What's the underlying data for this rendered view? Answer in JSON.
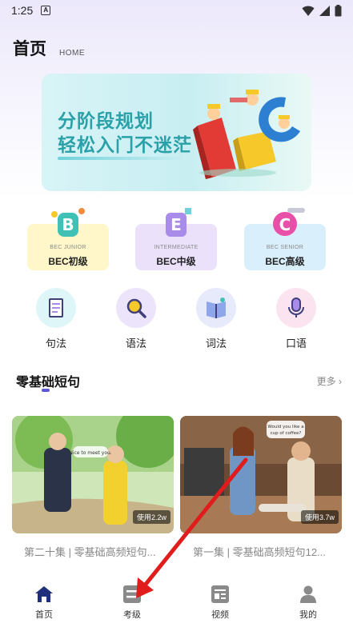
{
  "status_bar": {
    "time": "1:25",
    "a_badge": "A"
  },
  "header": {
    "title": "首页",
    "subtitle": "HOME"
  },
  "banner": {
    "line1": "分阶段规划",
    "line2": "轻松入门不迷茫"
  },
  "levels": [
    {
      "name": "BEC初级",
      "tag": "BEC JUNIOR",
      "color": "#fff6c9",
      "letter": "B"
    },
    {
      "name": "BEC中级",
      "tag": "INTERMEDIATE",
      "color": "#ebe1fb",
      "letter": "E"
    },
    {
      "name": "BEC高级",
      "tag": "BEC SENIOR",
      "color": "#d9effc",
      "letter": "C"
    }
  ],
  "skills": [
    {
      "label": "句法",
      "icon": "notebook-icon"
    },
    {
      "label": "语法",
      "icon": "magnifier-icon"
    },
    {
      "label": "词法",
      "icon": "book-icon"
    },
    {
      "label": "口语",
      "icon": "microphone-icon"
    }
  ],
  "section": {
    "title": "零基础短句",
    "more": "更多"
  },
  "videos": [
    {
      "caption": "第二十集 | 零基础高频短句...",
      "usage": "使用2.2w",
      "bubble": "Nice to meet you."
    },
    {
      "caption": "第一集 | 零基础高频短句12...",
      "usage": "使用3.7w",
      "bubble": "Would you like a cup of coffee?"
    }
  ],
  "nav": [
    {
      "label": "首页",
      "active": true
    },
    {
      "label": "考级",
      "active": false
    },
    {
      "label": "视频",
      "active": false
    },
    {
      "label": "我的",
      "active": false
    }
  ],
  "colors": {
    "accent": "#5b57d6",
    "banner_text": "#2aa0a8",
    "annotation_arrow": "#e11c1c"
  }
}
